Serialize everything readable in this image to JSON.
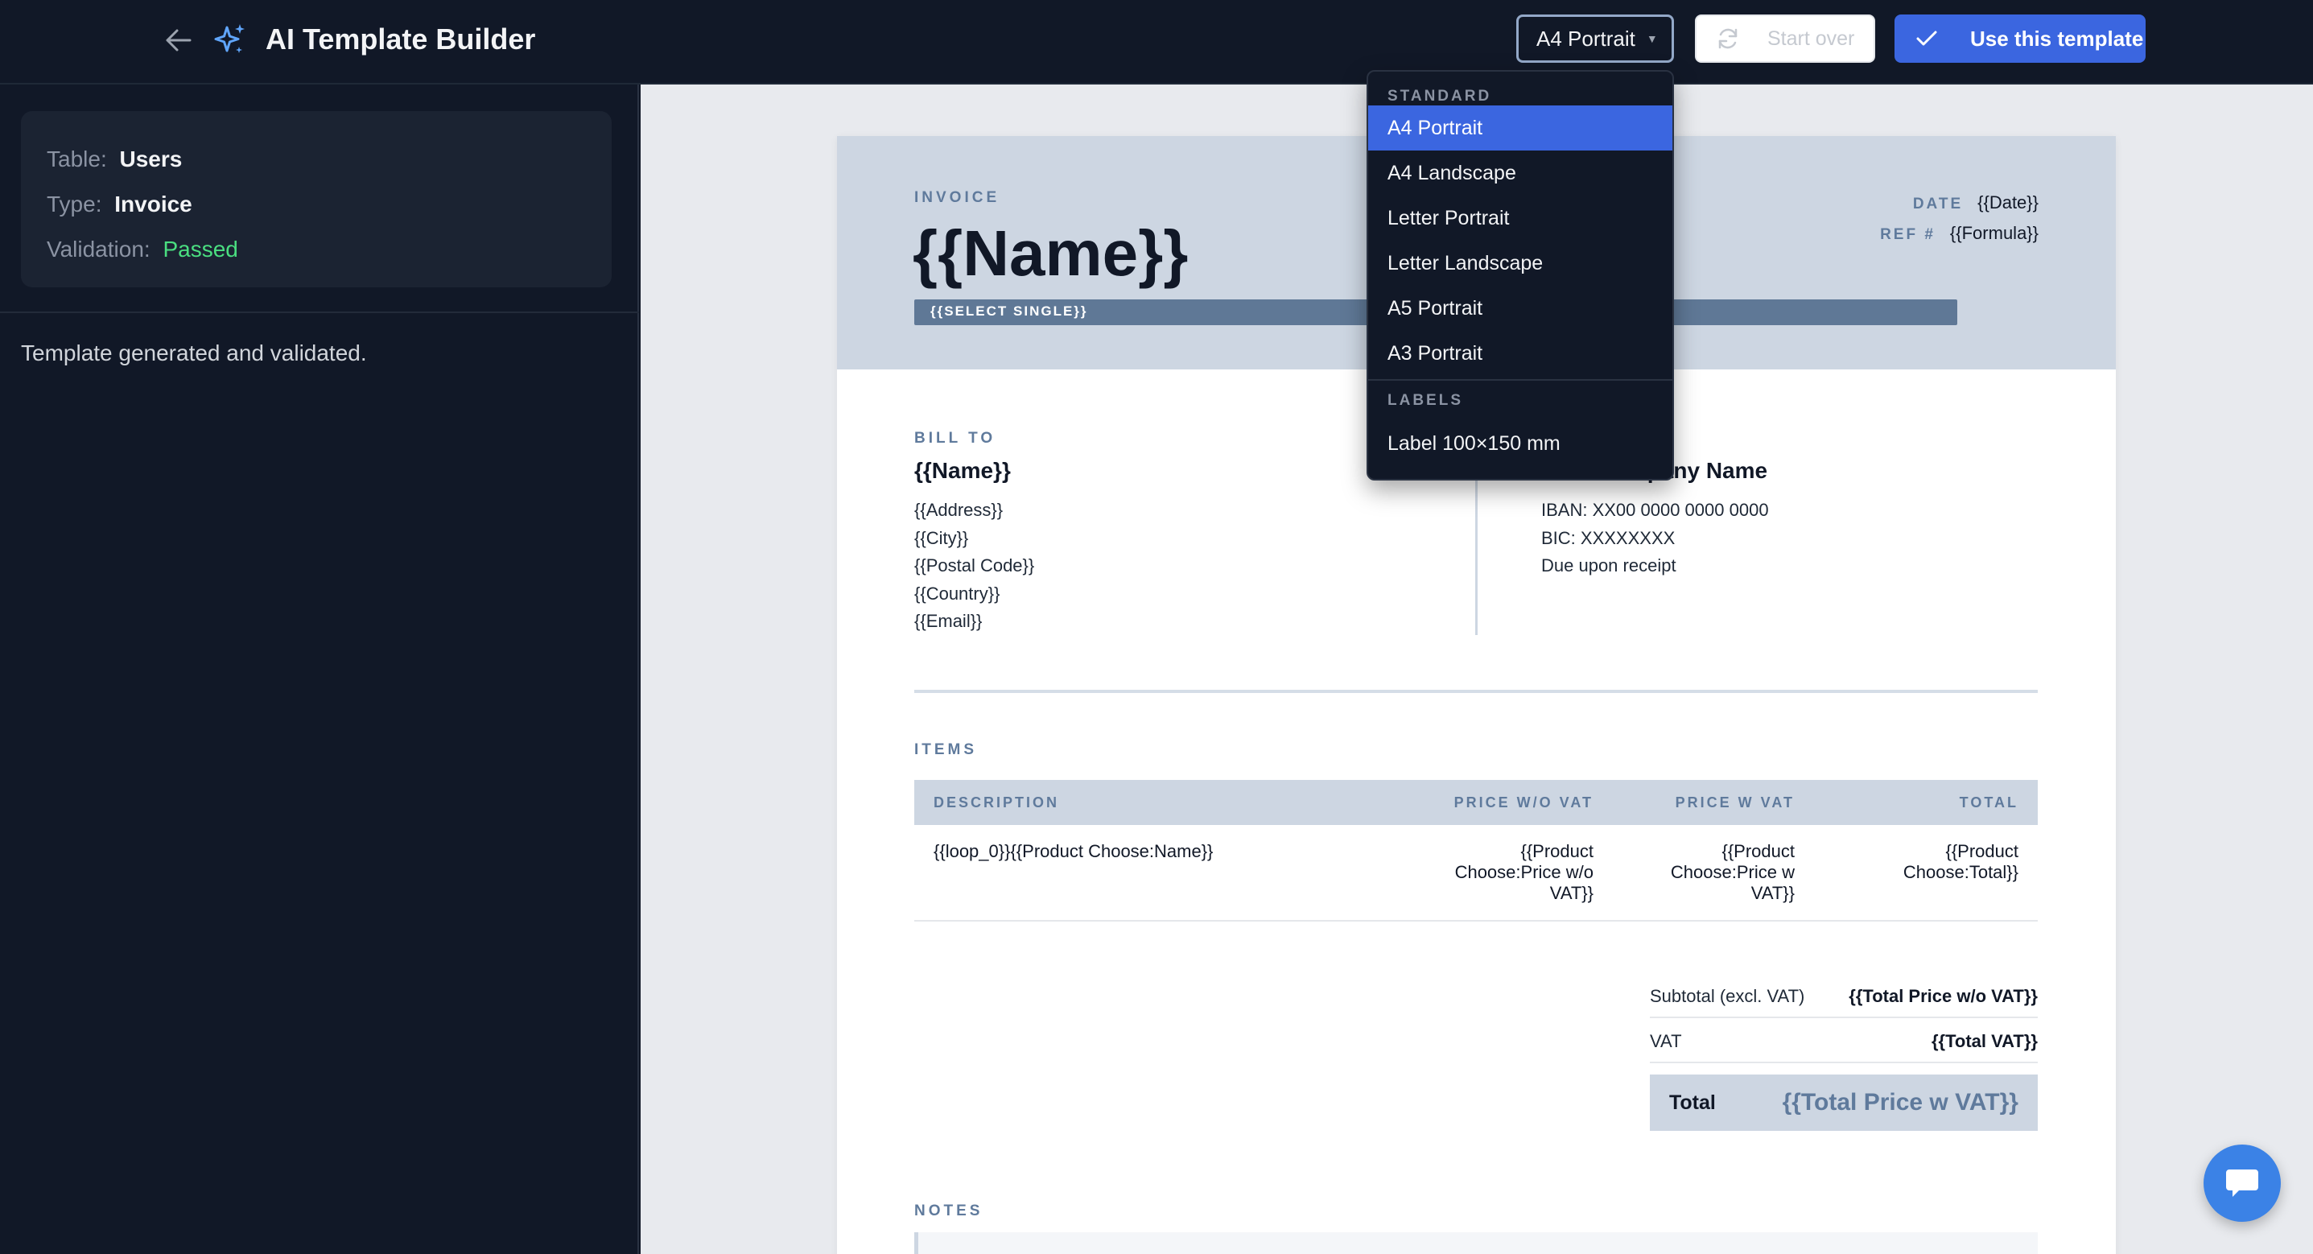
{
  "header": {
    "title": "AI Template Builder",
    "page_size": "A4 Portrait",
    "start_over_label": "Start over",
    "use_template_label": "Use this template"
  },
  "left_panel": {
    "table_label": "Table:",
    "table_value": "Users",
    "type_label": "Type:",
    "type_value": "Invoice",
    "validation_label": "Validation:",
    "validation_value": "Passed",
    "status_message": "Template generated and validated."
  },
  "page_size_menu": {
    "group_standard": "STANDARD",
    "standard_options": [
      "A4 Portrait",
      "A4 Landscape",
      "Letter Portrait",
      "Letter Landscape",
      "A5 Portrait",
      "A3 Portrait"
    ],
    "selected": "A4 Portrait",
    "group_labels": "LABELS",
    "label_options": [
      "Label 100×150 mm"
    ]
  },
  "invoice": {
    "kicker": "INVOICE",
    "name": "{{Name}}",
    "select_single": "{{SELECT SINGLE}}",
    "date_label": "DATE",
    "date_value": "{{Date}}",
    "ref_label": "REF #",
    "ref_value": "{{Formula}}",
    "bill_to_label": "BILL TO",
    "bill_to_name": "{{Name}}",
    "bill_to_lines": [
      "{{Address}}",
      "{{City}}",
      "{{Postal Code}}",
      "{{Country}}",
      "{{Email}}"
    ],
    "company_name": "Your Company Name",
    "company_lines": [
      "IBAN: XX00 0000 0000 0000",
      "BIC: XXXXXXXX",
      "Due upon receipt"
    ],
    "items_label": "ITEMS",
    "columns": [
      "DESCRIPTION",
      "PRICE W/O VAT",
      "PRICE W VAT",
      "TOTAL"
    ],
    "row": {
      "description": "{{loop_0}}{{Product Choose:Name}}",
      "price_wo_vat": [
        "{{Product",
        "Choose:Price w/o",
        "VAT}}"
      ],
      "price_w_vat": [
        "{{Product",
        "Choose:Price w",
        "VAT}}"
      ],
      "total": [
        "{{Product",
        "Choose:Total}}"
      ]
    },
    "subtotal_label": "Subtotal (excl. VAT)",
    "subtotal_value": "{{Total Price w/o VAT}}",
    "vat_label": "VAT",
    "vat_value": "{{Total VAT}}",
    "total_label": "Total",
    "total_value": "{{Total Price w VAT}}",
    "notes_label": "NOTES"
  }
}
